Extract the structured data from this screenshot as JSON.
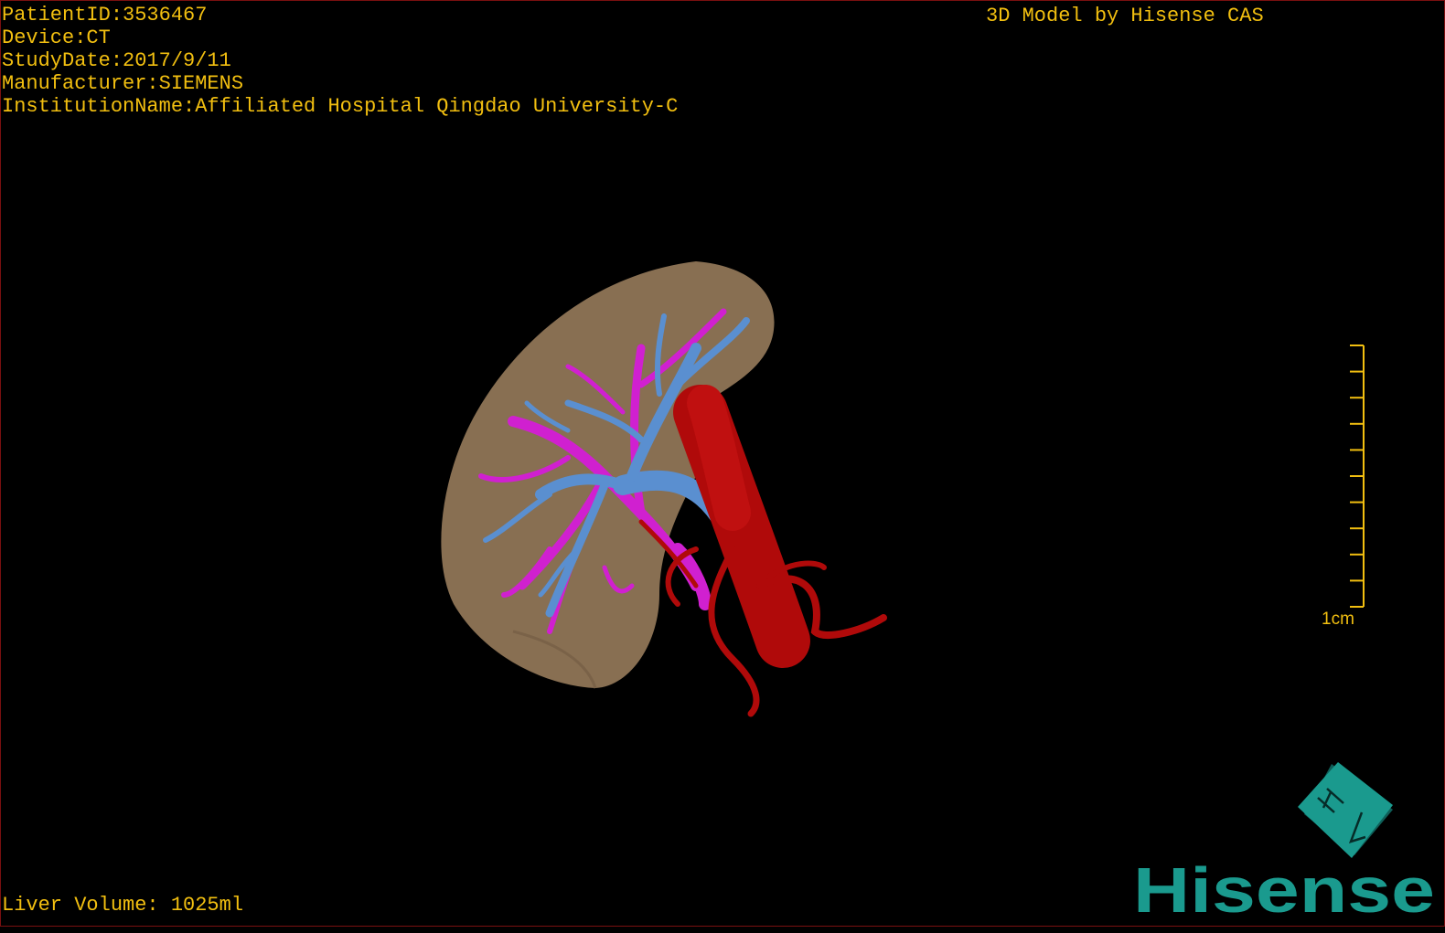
{
  "overlay": {
    "patient_id": "PatientID:3536467",
    "device": "Device:CT",
    "study_date": "StudyDate:2017/9/11",
    "manufacturer": "Manufacturer:SIEMENS",
    "institution": "InstitutionName:Affiliated Hospital Qingdao University-C",
    "title": "3D Model by Hisense CAS",
    "liver_volume": "Liver Volume: 1025ml"
  },
  "scale_bar": {
    "label": "1cm",
    "ticks": 11
  },
  "logo": {
    "text": "Hisense",
    "cube_marks": "H L",
    "color": "#1a9a8e"
  },
  "colors": {
    "text": "#f2bf10",
    "liver": "#a08260",
    "portal_vein": "#5a8fd0",
    "hepatic_vein": "#d020d0",
    "artery": "#b00a0a"
  }
}
